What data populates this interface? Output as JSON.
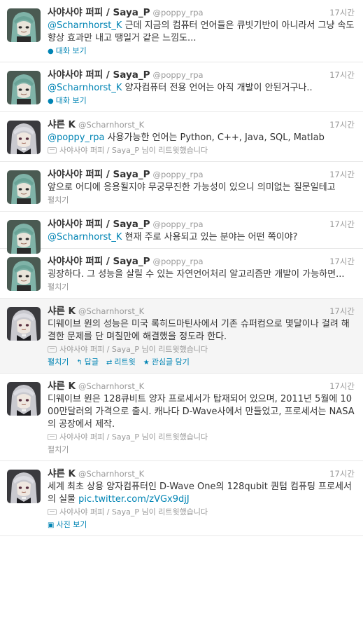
{
  "tweets": [
    {
      "avatar": "saya",
      "name": "사야사야 퍼피 / Saya_P",
      "handle": "@poppy_rpa",
      "time": "17시간",
      "mention": "@Scharnhorst_K",
      "text": " 근데 지금의 컴퓨터 언어들은 큐빗기반이 아니라서 그냥 속도향상 효과만 내고 땡일거 같은 느낌도...",
      "link": "",
      "retweet": "",
      "action": "대화 보기",
      "action_icon": "speech-bubble-icon"
    },
    {
      "avatar": "saya",
      "name": "사야사야 퍼피 / Saya_P",
      "handle": "@poppy_rpa",
      "time": "17시간",
      "mention": "@Scharnhorst_K",
      "text": " 양자컴퓨터 전용 언어는 아직 개발이 안된거구나..",
      "link": "",
      "retweet": "",
      "action": "대화 보기",
      "action_icon": "speech-bubble-icon"
    },
    {
      "avatar": "sharon",
      "name": "샤른 K",
      "handle": "@Scharnhorst_K",
      "time": "17시간",
      "mention": "@poppy_rpa",
      "text": " 사용가능한 언어는 Python, C++, Java, SQL, Matlab",
      "link": "",
      "retweet": "사야사야 퍼피 / Saya_P 님이 리트윗했습니다",
      "action": "",
      "action_icon": ""
    },
    {
      "avatar": "saya",
      "name": "사야사야 퍼피 / Saya_P",
      "handle": "@poppy_rpa",
      "time": "17시간",
      "mention": "",
      "text": "앞으로 어디에 응용될지야 무궁무진한 가능성이 있으니 의미없는 질문일테고",
      "link": "",
      "retweet": "",
      "action": "펼치기",
      "action_icon": ""
    },
    {
      "avatar": "saya",
      "name": "사야사야 퍼피 / Saya_P",
      "handle": "@poppy_rpa",
      "time": "17시간",
      "mention": "@Scharnhorst_K",
      "text": " 현재 주로 사용되고 있는 분야는 어떤 쪽이야?",
      "link": "",
      "retweet": "",
      "action": "",
      "action_icon": ""
    },
    {
      "avatar": "saya",
      "name": "사야사야 퍼피 / Saya_P",
      "handle": "@poppy_rpa",
      "time": "17시간",
      "mention": "",
      "text": "굉장하다. 그 성능을 살릴 수 있는 자연언어처리 알고리즘만 개발이 가능하면...",
      "link": "",
      "retweet": "",
      "action": "펼치기",
      "action_icon": ""
    },
    {
      "avatar": "sharon",
      "name": "샤른 K",
      "handle": "@Scharnhorst_K",
      "time": "17시간",
      "mention": "",
      "text": "디웨이브 원의 성능은 미국 록히드마틴사에서 기존 슈퍼컴으로 몇달이나 걸려 해결한 문제를 단 며칠만에 해결했을 정도라 한다.",
      "link": "",
      "retweet": "사야사야 퍼피 / Saya_P 님이 리트윗했습니다",
      "action": "",
      "action_icon": "",
      "highlight": true,
      "actions": [
        "펼치기",
        "답글",
        "리트윗",
        "관심글 담기"
      ]
    },
    {
      "avatar": "sharon",
      "name": "샤른 K",
      "handle": "@Scharnhorst_K",
      "time": "17시간",
      "mention": "",
      "text": "디웨이브 원은 128큐비트 양자 프로세서가 탑재되어 있으며, 2011년 5월에 1000만달러의 가격으로 출시. 캐나다 D-Wave사에서 만들었고, 프로세서는 NASA의 공장에서 제작.",
      "link": "",
      "retweet": "사야사야 퍼피 / Saya_P 님이 리트윗했습니다",
      "action": "펼치기",
      "action_icon": ""
    },
    {
      "avatar": "sharon",
      "name": "샤른 K",
      "handle": "@Scharnhorst_K",
      "time": "17시간",
      "mention": "",
      "text": "세계 최초 상용 양자컴퓨터인 D-Wave One의 128qubit 퀀텀 컴퓨팅 프로세서의 실물 ",
      "link": "pic.twitter.com/zVGx9djJ",
      "retweet": "사야사야 퍼피 / Saya_P 님이 리트윗했습니다",
      "action": "사진 보기",
      "action_icon": "photo-icon"
    }
  ],
  "colors": {
    "link": "#0084b4",
    "muted": "#999999",
    "text": "#333333",
    "highlight_bg": "#f5f5f5"
  }
}
